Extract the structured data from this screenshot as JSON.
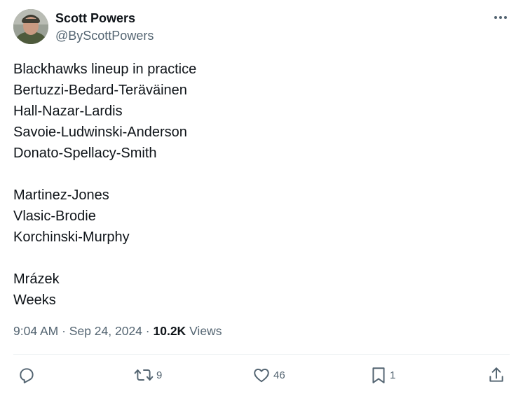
{
  "author": {
    "name": "Scott Powers",
    "handle": "@ByScottPowers"
  },
  "tweet": {
    "lines": [
      "Blackhawks lineup in practice",
      "Bertuzzi-Bedard-Teräväinen",
      "Hall-Nazar-Lardis",
      "Savoie-Ludwinski-Anderson",
      "Donato-Spellacy-Smith",
      "",
      "Martinez-Jones",
      "Vlasic-Brodie",
      "Korchinski-Murphy",
      "",
      "Mrázek",
      "Weeks"
    ],
    "time": "9:04 AM",
    "date": "Sep 24, 2024",
    "sep": "·",
    "views_count": "10.2K",
    "views_label": "Views"
  },
  "actions": {
    "reply_icon": "reply-icon",
    "retweet_icon": "retweet-icon",
    "retweet_count": "9",
    "like_icon": "heart-icon",
    "like_count": "46",
    "bookmark_icon": "bookmark-icon",
    "bookmark_count": "1",
    "share_icon": "share-icon"
  },
  "colors": {
    "text": "#0f1419",
    "secondary": "#536471",
    "divider": "#eff3f4"
  }
}
